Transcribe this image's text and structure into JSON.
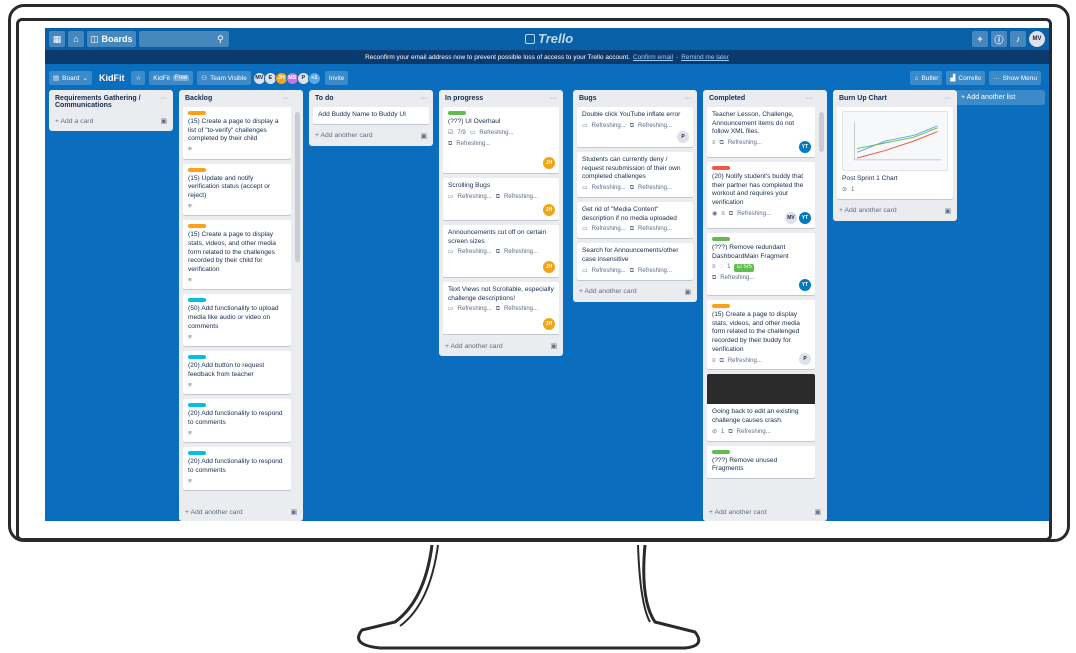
{
  "topbar": {
    "boards_label": "Boards",
    "logo": "Trello",
    "user_initials": "MV"
  },
  "banner": {
    "text": "Reconfirm your email address now to prevent possible loss of access to your Trello account.",
    "confirm": "Confirm email",
    "remind": "Remind me later"
  },
  "board": {
    "view_label": "Board",
    "title": "KidFit",
    "team": "KidFit",
    "plan": "Free",
    "visibility": "Team Visible",
    "members": [
      "MV",
      "E",
      "JH",
      "MS",
      "P"
    ],
    "more_members": "+1",
    "invite": "Invite",
    "butler": "Butler",
    "corrello": "Corrello",
    "show_menu": "Show Menu"
  },
  "add_card": "+ Add a card",
  "add_another_card": "+ Add another card",
  "add_list": "+ Add another list",
  "refreshing": "Refreshing...",
  "lists": {
    "req": {
      "title": "Requirements Gathering / Communications"
    },
    "backlog": {
      "title": "Backlog",
      "cards": [
        "(15) Create a page to display a list of \"to-verify\" challenges completed by their child",
        "(15) Update and notify verification status (accept or reject)",
        "(15) Create a page to display stats, videos, and other media form related to the challenges recorded by their child for verification",
        "(50) Add functionality to upload media like audio or video on comments",
        "(20) Add button to request feedback from teacher",
        "(20) Add functionality to respond to comments",
        "(20) Add functionality to respond to comments"
      ]
    },
    "todo": {
      "title": "To do",
      "cards": [
        "Add Buddy Name to Buddy UI"
      ]
    },
    "progress": {
      "title": "In progress",
      "cards": [
        "(???) UI Overhaul",
        "Scrolling Bugs",
        "Announcements cut off on certain screen sizes",
        "Text Views not Scrollable, especially challenge descriptions!"
      ],
      "checklist": "7/9"
    },
    "bugs": {
      "title": "Bugs",
      "cards": [
        "Double click YouTube inflate error",
        "Students can currently deny / request resubmission of their own completed challenges",
        "Get rid of \"Media Content\" description if no media uploaded",
        "Search for Announcements/other case insensitive"
      ]
    },
    "completed": {
      "title": "Completed",
      "cards": [
        "Teacher Lesson, Challenge, Announcement items do not follow XML files.",
        "(20) Notify student's buddy that their partner has completed the workout and requires your verification",
        "(???) Remove redundant DashboardMain Fragment",
        "(15) Create a page to display stats, videos, and other media form related to the challenged recorded by their buddy for verification",
        "Going back to edit an existing challenge causes crash.",
        "(???) Remove unused Fragments"
      ],
      "comments": "1",
      "checklist": "5/5",
      "attachments": "1"
    },
    "burnup": {
      "title": "Burn Up Chart",
      "card": "Post Sprint 1 Chart",
      "attachments": "1"
    }
  },
  "colors": {
    "orange": "#ff9f1a",
    "green": "#61bd4f",
    "teal": "#00c2e0",
    "red": "#eb5a46",
    "board": "#0a6dbd"
  }
}
